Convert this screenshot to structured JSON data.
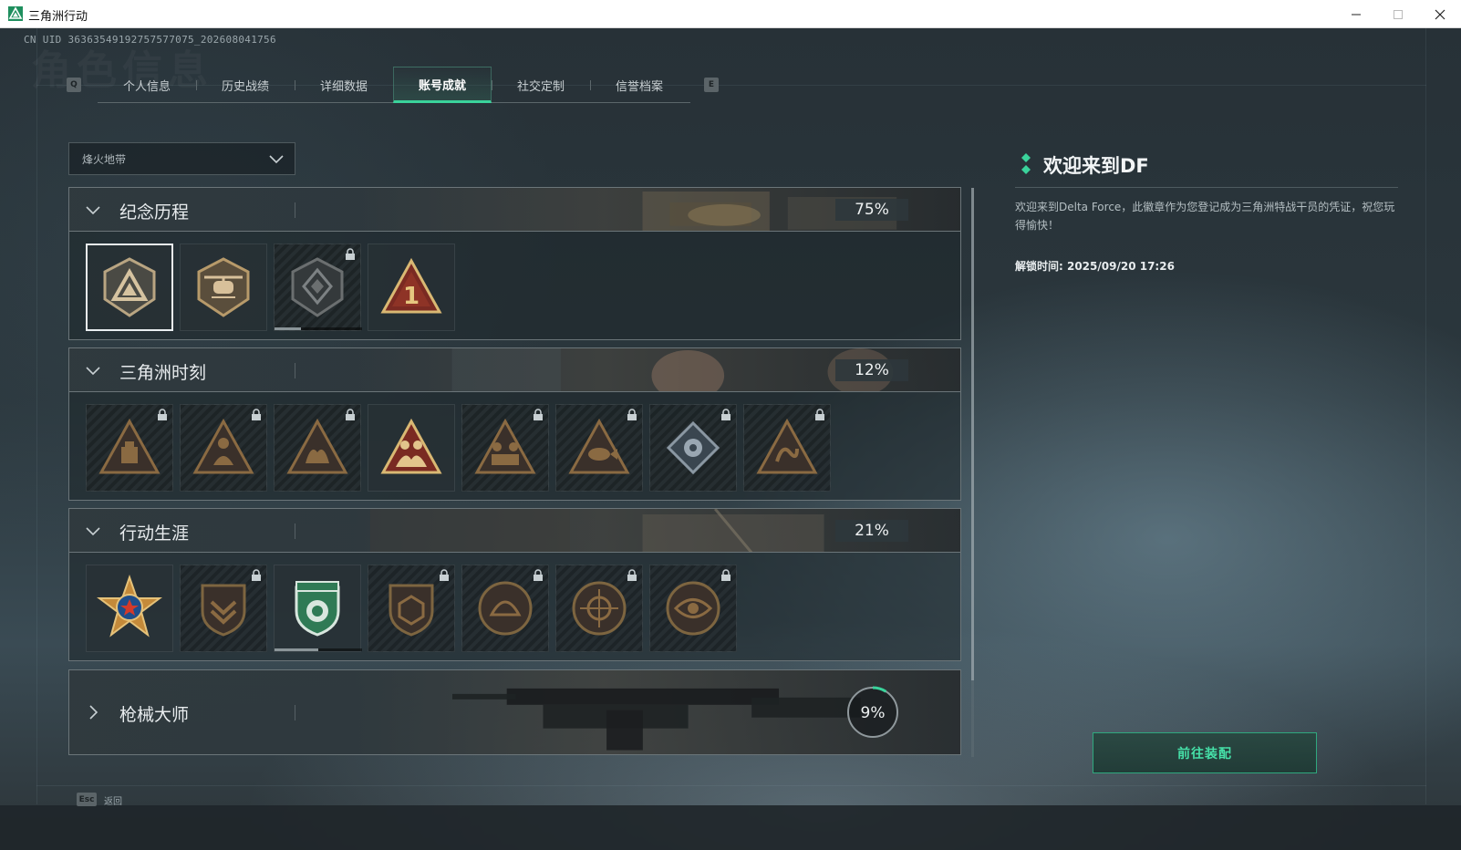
{
  "window": {
    "title": "三角洲行动"
  },
  "header": {
    "uid": "CN UID 363635491927575770​75_202608041756",
    "bg_watermark": "角色信息"
  },
  "tabs": {
    "prev_key": "Q",
    "next_key": "E",
    "items": [
      {
        "label": "个人信息",
        "active": false
      },
      {
        "label": "历史战绩",
        "active": false
      },
      {
        "label": "详细数据",
        "active": false
      },
      {
        "label": "账号成就",
        "active": true
      },
      {
        "label": "社交定制",
        "active": false
      },
      {
        "label": "信誉档案",
        "active": false
      }
    ]
  },
  "filter": {
    "selected": "烽火地带"
  },
  "categories": [
    {
      "title": "纪念历程",
      "progress": "75%",
      "expanded": true,
      "badges": [
        {
          "icon": "delta-logo-badge-icon",
          "locked": false,
          "selected": true
        },
        {
          "icon": "helicopter-badge-icon",
          "locked": false
        },
        {
          "icon": "diamond-emblem-badge-icon",
          "locked": true,
          "progress": 0.3
        },
        {
          "icon": "number-one-badge-icon",
          "locked": false
        }
      ]
    },
    {
      "title": "三角洲时刻",
      "progress": "12%",
      "expanded": true,
      "badges": [
        {
          "icon": "supply-crate-badge-icon",
          "locked": true
        },
        {
          "icon": "soldier-badge-icon",
          "locked": true
        },
        {
          "icon": "hands-badge-icon",
          "locked": true
        },
        {
          "icon": "squad-badge-icon",
          "locked": false
        },
        {
          "icon": "team-badge-icon",
          "locked": true
        },
        {
          "icon": "fish-badge-icon",
          "locked": true
        },
        {
          "icon": "flower-badge-icon",
          "locked": true
        },
        {
          "icon": "serpent-badge-icon",
          "locked": true
        }
      ]
    },
    {
      "title": "行动生涯",
      "progress": "21%",
      "expanded": true,
      "badges": [
        {
          "icon": "star-medal-badge-icon",
          "locked": false
        },
        {
          "icon": "chevron-shield-badge-icon",
          "locked": true
        },
        {
          "icon": "green-shield-badge-icon",
          "locked": false,
          "progress": 0.5
        },
        {
          "icon": "dice-shield-badge-icon",
          "locked": true
        },
        {
          "icon": "shell-badge-icon",
          "locked": true
        },
        {
          "icon": "crosshair-badge-icon",
          "locked": true
        },
        {
          "icon": "eye-badge-icon",
          "locked": true
        }
      ]
    },
    {
      "title": "枪械大师",
      "progress": "9%",
      "progress_value": 0.09,
      "expanded": false
    }
  ],
  "detail": {
    "title": "欢迎来到DF",
    "description": "欢迎来到Delta Force，此徽章作为您登记成为三角洲特战干员的凭证，祝您玩得愉快！",
    "unlock_label": "解锁时间: 2025/09/20 17:26",
    "equip_button": "前往装配"
  },
  "footer": {
    "esc_key": "Esc",
    "back_label": "返回"
  },
  "colors": {
    "accent": "#3ad39b",
    "gold": "#c9a35a",
    "bronze": "#b08a4a"
  }
}
